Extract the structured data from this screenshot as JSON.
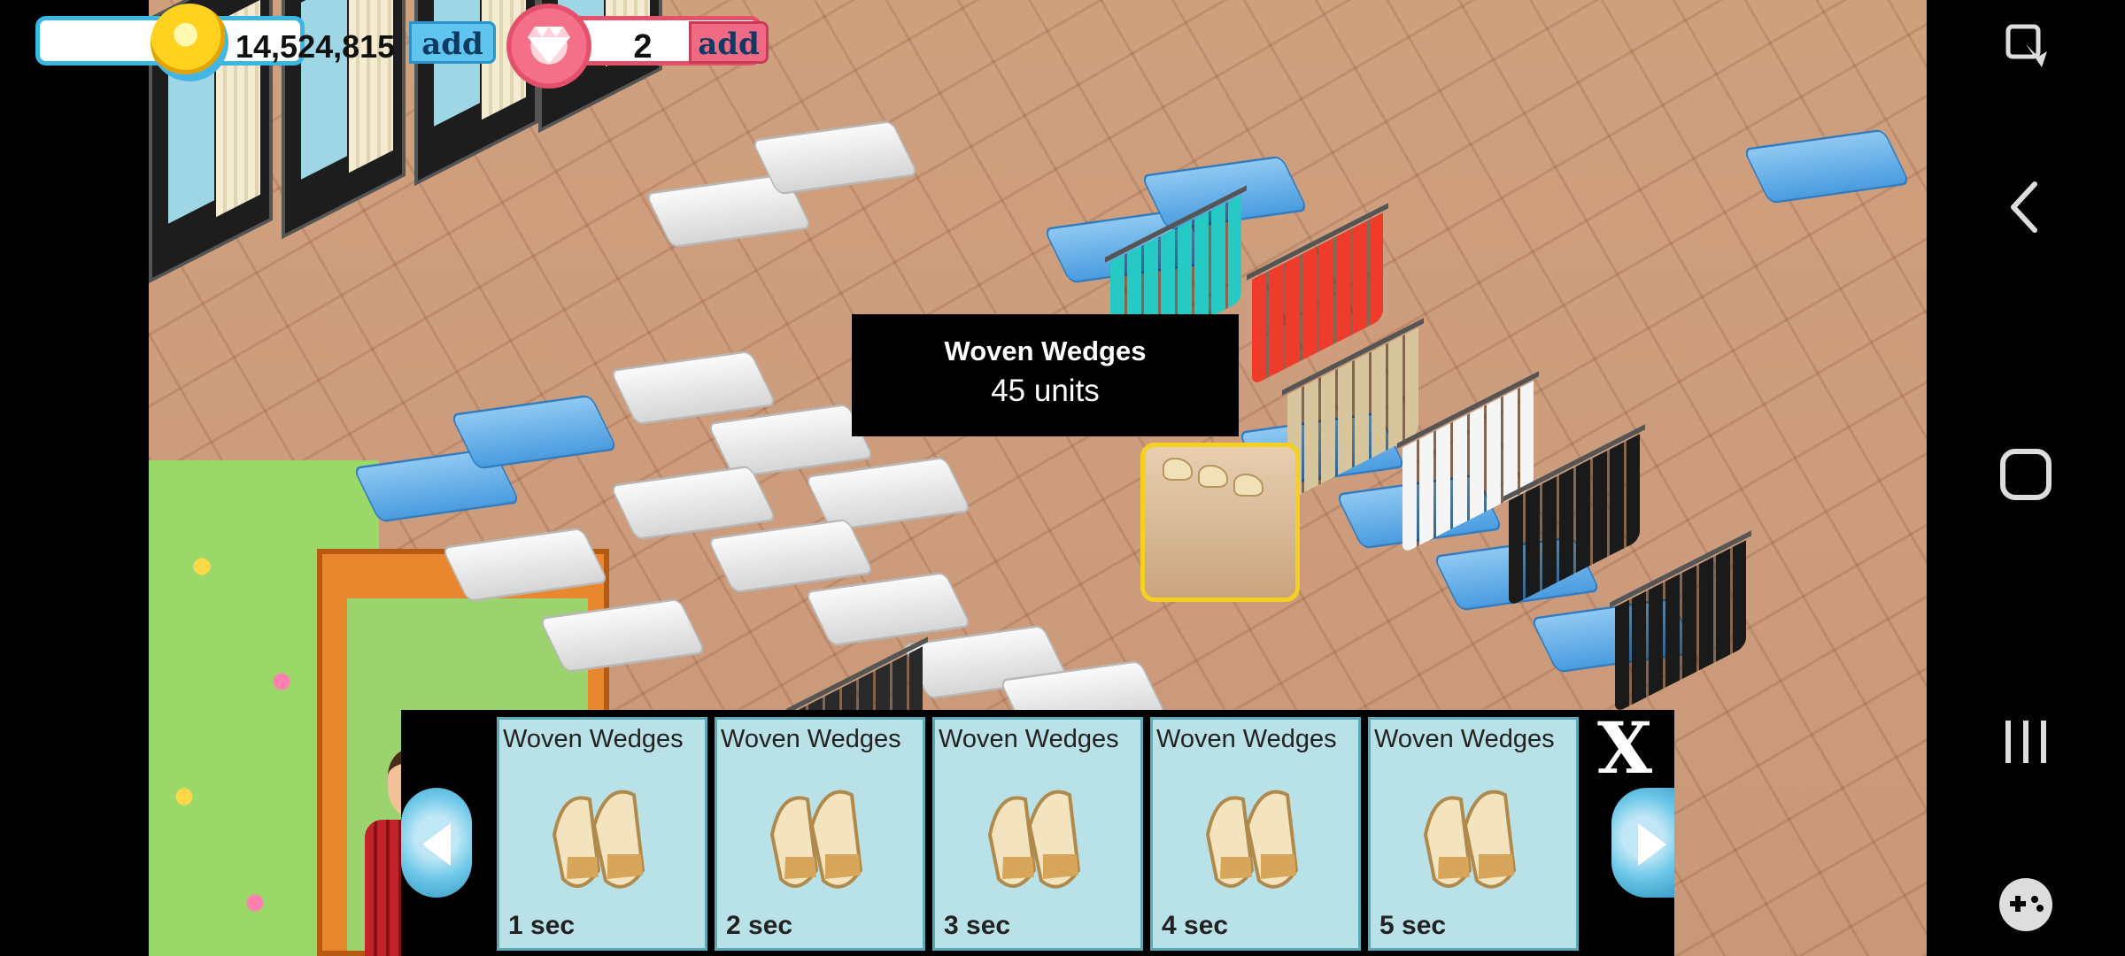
{
  "hud": {
    "coins": {
      "amount": "14,524,815",
      "add_label": "add",
      "icon": "coin-icon"
    },
    "gems": {
      "amount": "2",
      "add_label": "add",
      "icon": "gem-icon"
    }
  },
  "tooltip": {
    "name": "Woven Wedges",
    "units": "45 units"
  },
  "item_bar": {
    "items": [
      {
        "name": "Woven Wedges",
        "time": "1 sec"
      },
      {
        "name": "Woven Wedges",
        "time": "2 sec"
      },
      {
        "name": "Woven Wedges",
        "time": "3 sec"
      },
      {
        "name": "Woven Wedges",
        "time": "4 sec"
      },
      {
        "name": "Woven Wedges",
        "time": "5 sec"
      }
    ],
    "close_label": "X"
  },
  "system_nav": [
    "screen-capture-icon",
    "back-icon",
    "home-icon",
    "recents-icon",
    "game-tools-icon"
  ],
  "colors": {
    "coin_ring": "#39b7e3",
    "gem_ring": "#e6506a",
    "card_bg": "#b9e1e8"
  }
}
